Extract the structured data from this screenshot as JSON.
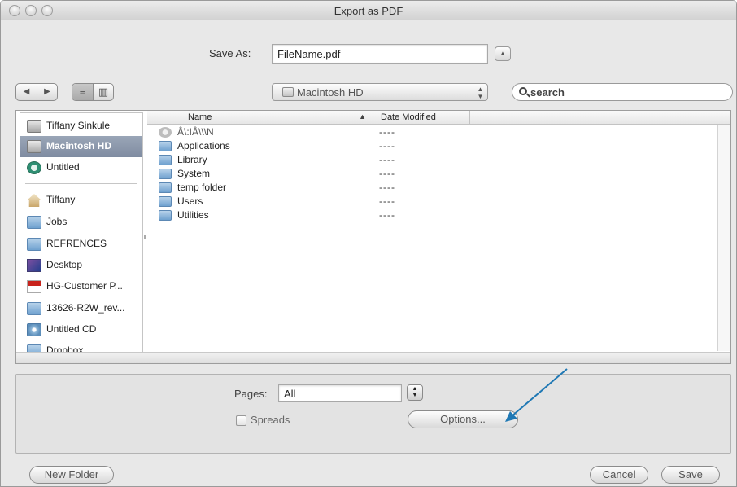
{
  "window": {
    "title": "Export as PDF"
  },
  "save_as": {
    "label": "Save As:",
    "filename": "FileName.pdf",
    "expand_icon": "disclosure-up-arrow"
  },
  "toolbar": {
    "back_icon": "◀",
    "forward_icon": "▶",
    "list_view_icon": "≡",
    "column_view_icon": "▥",
    "location": "Macintosh HD",
    "search_placeholder": "search"
  },
  "sidebar": {
    "items": [
      {
        "label": "Tiffany Sinkule",
        "icon": "disk"
      },
      {
        "label": "Macintosh HD",
        "icon": "disk",
        "selected": true
      },
      {
        "label": "Untitled",
        "icon": "timemachine"
      },
      {
        "label": "Tiffany",
        "icon": "home"
      },
      {
        "label": "Jobs",
        "icon": "folder"
      },
      {
        "label": "REFRENCES",
        "icon": "folder"
      },
      {
        "label": "Desktop",
        "icon": "desktop"
      },
      {
        "label": "HG-Customer P...",
        "icon": "pdf"
      },
      {
        "label": "13626-R2W_rev...",
        "icon": "folder"
      },
      {
        "label": "Untitled CD",
        "icon": "cd"
      },
      {
        "label": "Dropbox",
        "icon": "folder"
      }
    ]
  },
  "file_list": {
    "columns": {
      "name": "Name",
      "date_modified": "Date Modified"
    },
    "sort_indicator": "▲",
    "rows": [
      {
        "name": "Å\\:IÅ\\\\\\N",
        "date": "----",
        "icon": "gear"
      },
      {
        "name": "Applications",
        "date": "----",
        "icon": "folder"
      },
      {
        "name": "Library",
        "date": "----",
        "icon": "folder"
      },
      {
        "name": "System",
        "date": "----",
        "icon": "folder"
      },
      {
        "name": "temp folder",
        "date": "----",
        "icon": "folder"
      },
      {
        "name": "Users",
        "date": "----",
        "icon": "folder"
      },
      {
        "name": "Utilities",
        "date": "----",
        "icon": "folder"
      }
    ]
  },
  "options": {
    "pages_label": "Pages:",
    "pages_value": "All",
    "spreads_label": "Spreads",
    "spreads_checked": false,
    "options_button": "Options..."
  },
  "buttons": {
    "new_folder": "New Folder",
    "cancel": "Cancel",
    "save": "Save"
  },
  "colors": {
    "selection": "#8592a6",
    "annotation_arrow": "#1f78b4"
  }
}
